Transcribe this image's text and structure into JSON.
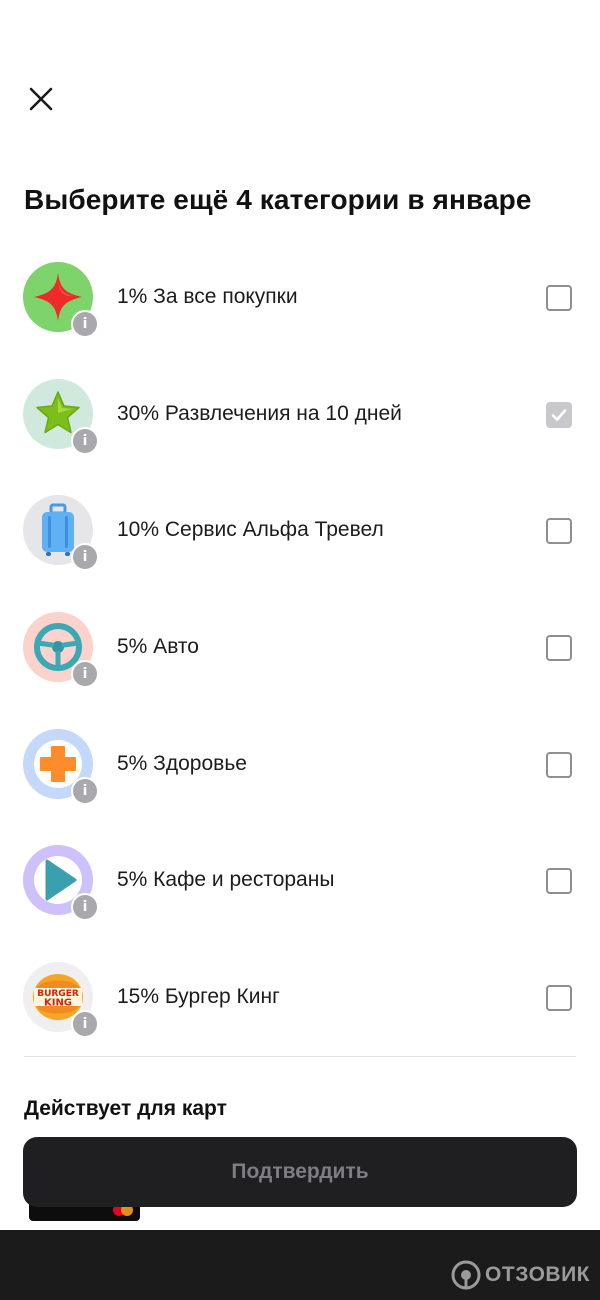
{
  "header": {
    "close_icon": "close-icon",
    "title": "Выберите ещё 4 категории в январе"
  },
  "categories": [
    {
      "label": "1% За все покупки",
      "icon": "red-star-icon",
      "bg": "#7ed36a",
      "checked": false
    },
    {
      "label": "30% Развлечения на 10 дней",
      "icon": "green-star-icon",
      "bg": "#cfe9dd",
      "checked": true
    },
    {
      "label": "10% Сервис Альфа Тревел",
      "icon": "suitcase-icon",
      "bg": "#e6e6e8",
      "checked": false
    },
    {
      "label": "5% Авто",
      "icon": "steering-wheel-icon",
      "bg": "#fbd2cc",
      "checked": false
    },
    {
      "label": "5% Здоровье",
      "icon": "medical-cross-icon",
      "bg": "#c4d8fb",
      "checked": false
    },
    {
      "label": "5% Кафе и рестораны",
      "icon": "play-icon",
      "bg": "#cdc0fb",
      "checked": false
    },
    {
      "label": "15% Бургер Кинг",
      "icon": "burger-king-logo",
      "bg": "#f0eeee",
      "checked": false
    }
  ],
  "info_badge": "i",
  "section": {
    "label": "Действует для карт"
  },
  "confirm_button": {
    "label": "Подтвердить"
  },
  "watermark": {
    "text": "ОТЗОВИК"
  },
  "colors": {
    "button_bg": "#1f1f21",
    "button_text": "#7d7d82",
    "checkbox_border": "#8e8e93",
    "checkbox_checked": "#c7c7cc"
  }
}
